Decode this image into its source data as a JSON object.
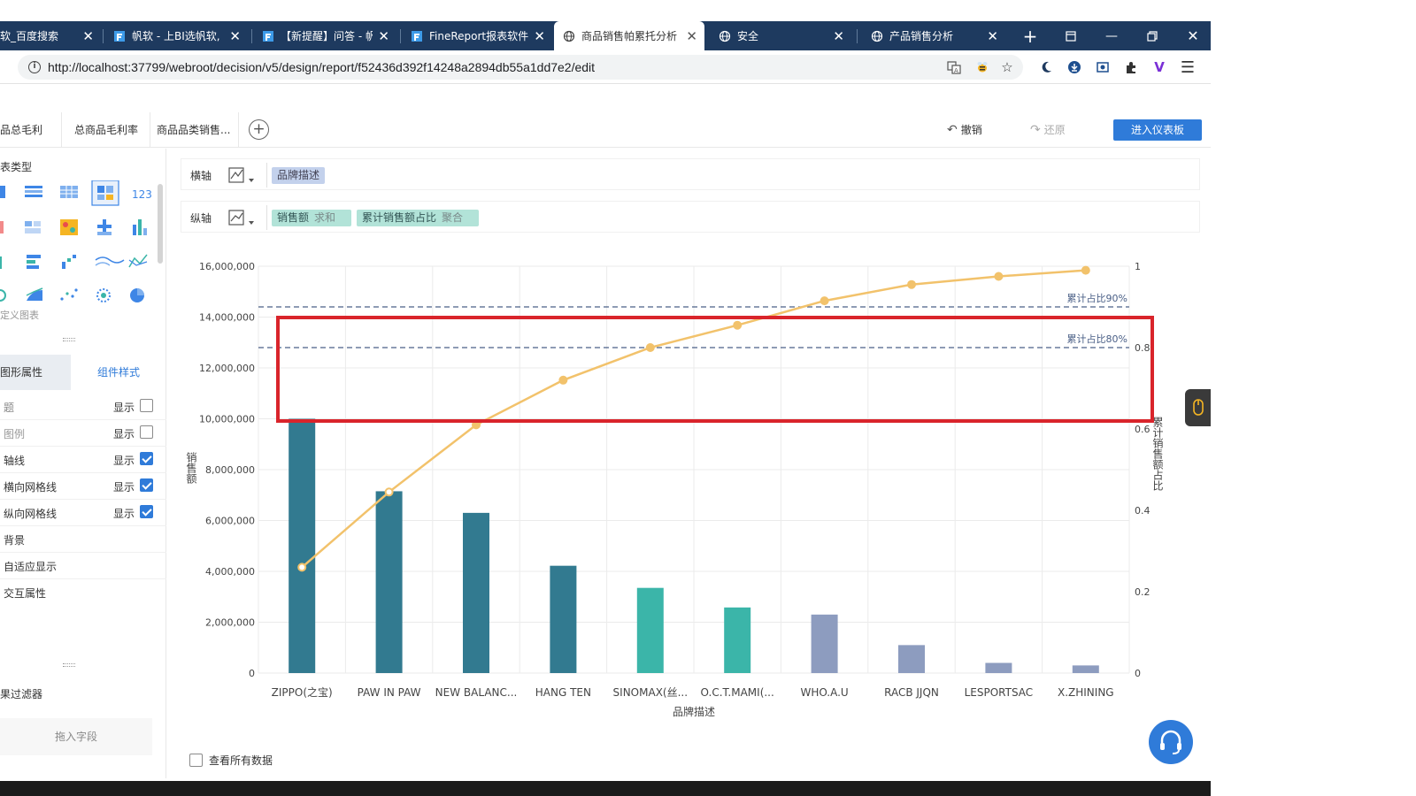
{
  "browser": {
    "tabs": [
      {
        "label": "软_百度搜索",
        "icon": "none"
      },
      {
        "label": "帆软 - 上BI选帆软,",
        "icon": "fanruan"
      },
      {
        "label": "【新提醒】问答 - 帆",
        "icon": "fanruan"
      },
      {
        "label": "FineReport报表软件",
        "icon": "fanruan"
      },
      {
        "label": "商品销售帕累托分析",
        "icon": "globe",
        "active": true
      },
      {
        "label": "安全",
        "icon": "globe"
      },
      {
        "label": "产品销售分析",
        "icon": "globe"
      }
    ],
    "url": "http://localhost:37799/webroot/decision/v5/design/report/f52436d392f14248a2894db55a1dd7e2/edit"
  },
  "header": {
    "sheet_tabs": [
      "品总毛利",
      "总商品毛利率",
      "商品品类销售..."
    ],
    "undo_label": "撤销",
    "redo_label": "还原",
    "enter_dashboard_label": "进入仪表板"
  },
  "left_panel": {
    "chart_type_title": "表类型",
    "custom_chart_label": "定义图表",
    "prop_tab_graphic": "图形属性",
    "prop_tab_component": "组件样式",
    "show_label": "显示",
    "properties": [
      {
        "label": "题",
        "checkbox": true,
        "checked": false
      },
      {
        "label": "图例",
        "checkbox": true,
        "checked": false,
        "muted": true
      },
      {
        "label": "轴线",
        "checkbox": true,
        "checked": true
      },
      {
        "label": "横向网格线",
        "checkbox": true,
        "checked": true
      },
      {
        "label": "纵向网格线",
        "checkbox": true,
        "checked": true
      },
      {
        "label": "背景",
        "checkbox": false
      },
      {
        "label": "自适应显示",
        "checkbox": false
      },
      {
        "label": "交互属性",
        "checkbox": false
      }
    ],
    "filter_title": "果过滤器",
    "drop_field_label": "拖入字段"
  },
  "axes": {
    "x_row_label": "横轴",
    "x_field": "品牌描述",
    "y_row_label": "纵轴",
    "y_fields": [
      {
        "name": "销售额",
        "agg": "求和"
      },
      {
        "name": "累计销售额占比",
        "agg": "聚合"
      }
    ]
  },
  "chart_data": {
    "type": "bar",
    "categories": [
      "ZIPPO(之宝)",
      "PAW IN PAW",
      "NEW BALANC...",
      "HANG TEN",
      "SINOMAX(丝...",
      "O.C.T.MAMI(...",
      "WHO.A.U",
      "RACB JJQN",
      "LESPORTSAC",
      "X.ZHINING"
    ],
    "series": [
      {
        "name": "销售额",
        "type": "bar",
        "axis": "left",
        "values": [
          10000000,
          7150000,
          6300000,
          4220000,
          3350000,
          2580000,
          2300000,
          1100000,
          400000,
          300000
        ],
        "colors": [
          "#327a90",
          "#327a90",
          "#327a90",
          "#327a90",
          "#3bb5a9",
          "#3bb5a9",
          "#8d9cbf",
          "#8d9cbf",
          "#8d9cbf",
          "#8d9cbf"
        ]
      },
      {
        "name": "累计销售额占比",
        "type": "line",
        "axis": "right",
        "values": [
          0.26,
          0.445,
          0.61,
          0.72,
          0.8,
          0.855,
          0.915,
          0.955,
          0.975,
          0.99
        ],
        "color": "#f2c26b"
      }
    ],
    "xlabel": "品牌描述",
    "ylabel": "销售额",
    "y2label": "累计销售额占比",
    "ylim": [
      0,
      16000000
    ],
    "yticks": [
      "0",
      "2,000,000",
      "4,000,000",
      "6,000,000",
      "8,000,000",
      "10,000,000",
      "12,000,000",
      "14,000,000",
      "16,000,000"
    ],
    "y2lim": [
      0,
      1
    ],
    "y2ticks": [
      "0",
      "0.2",
      "0.4",
      "0.6",
      "0.8",
      "1"
    ],
    "reference_lines": [
      {
        "label": "累计占比90%",
        "value": 0.9,
        "color": "#4a5f86"
      },
      {
        "label": "累计占比80%",
        "value": 0.8,
        "color": "#4a5f86"
      }
    ],
    "grid": true,
    "legend": "none"
  },
  "footer": {
    "view_all_label": "查看所有数据"
  },
  "colors": {
    "tab_bar": "#1e3a5f",
    "primary": "#2f7bd9",
    "highlight": "#d9242b",
    "x_pill": "#c3d1ec",
    "y_pill": "#b2e3d8"
  }
}
